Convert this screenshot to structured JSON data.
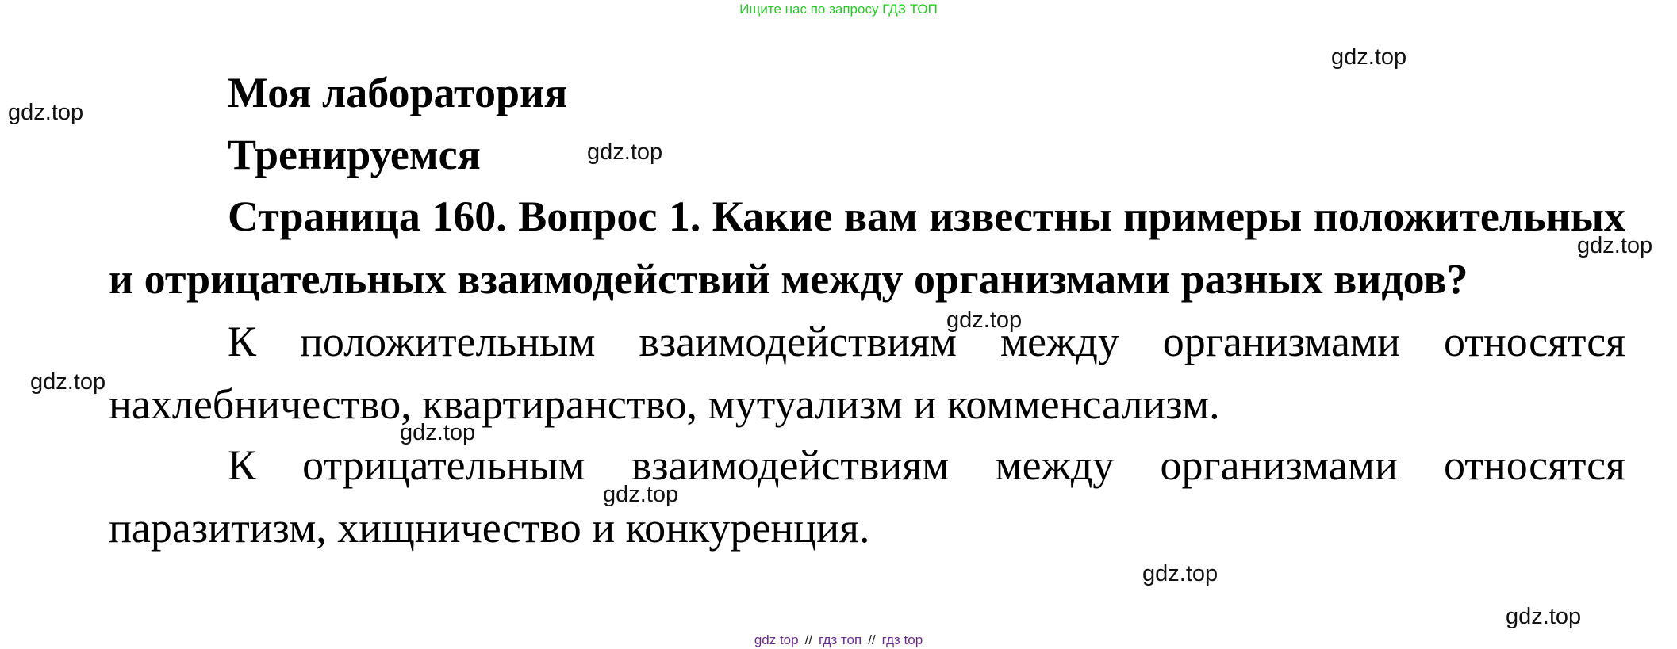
{
  "banner": {
    "top": "Ищите нас по запросу ГДЗ ТОП",
    "bottom": [
      "gdz top",
      "//",
      "гдз топ",
      "//",
      "гдз top"
    ]
  },
  "document": {
    "heading1": "Моя лаборатория",
    "heading2": "Тренируемся",
    "question": "Страница 160. Вопрос 1. Какие вам известны примеры положительных и отрицательных взаимодействий между организмами разных видов?",
    "answers": [
      "К положительным взаимодействиям между организмами относятся нахлебничество, квартиранство, мутуализм и комменсализм.",
      "К отрицательным взаимодействиям между организмами относятся паразитизм, хищничество и конкуренция."
    ]
  },
  "watermarks": [
    "gdz.top",
    "gdz.top",
    "gdz.top",
    "gdz.top",
    "gdz.top",
    "gdz.top",
    "gdz.top",
    "gdz.top",
    "gdz.top",
    "gdz.top"
  ],
  "colors": {
    "banner_top": "#28c828",
    "banner_bottom": "#6a2c8a",
    "text": "#000000"
  }
}
